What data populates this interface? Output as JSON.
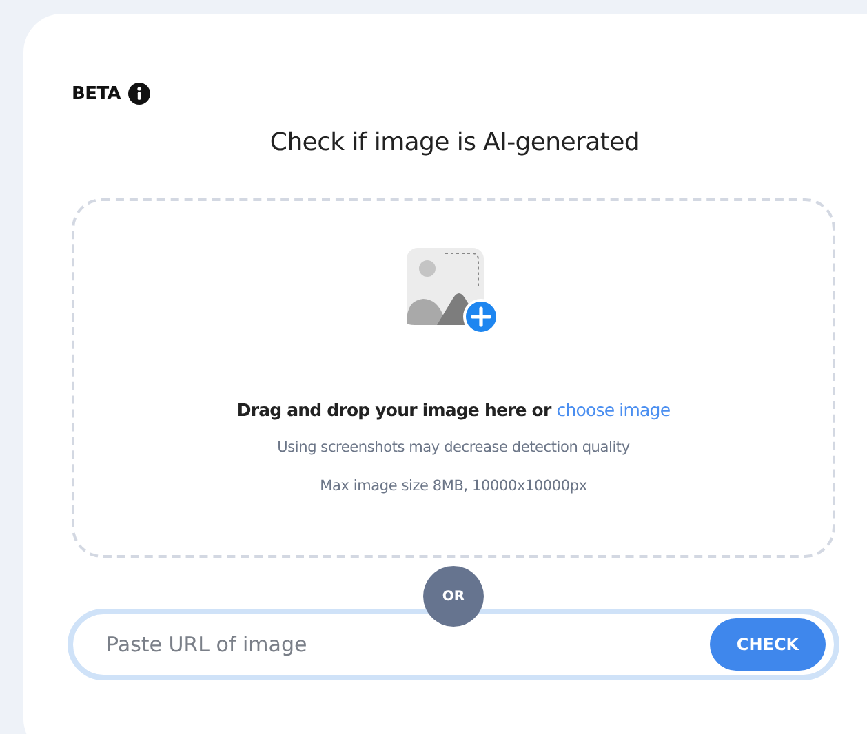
{
  "badge": {
    "label": "BETA"
  },
  "title": "Check if image is AI-generated",
  "dropzone": {
    "prompt": "Drag and drop your image here or",
    "link": "choose image",
    "note": "Using screenshots may decrease detection quality",
    "limits": "Max image size 8MB, 10000x10000px"
  },
  "divider": "OR",
  "url_field": {
    "placeholder": "Paste URL of image"
  },
  "button": "CHECK"
}
